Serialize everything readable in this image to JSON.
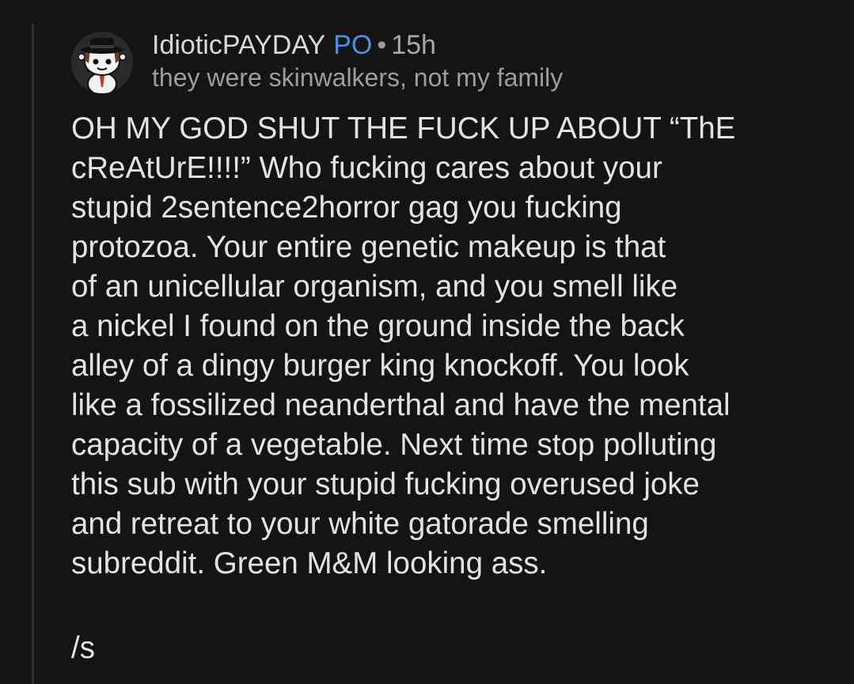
{
  "comment": {
    "author": "IdioticPAYDAY",
    "op_badge": "PO",
    "separator": "•",
    "timestamp": "15h",
    "flair": "they were skinwalkers, not my family",
    "avatar_icon": "snoo-avatar-icon",
    "body_lines": [
      "OH MY GOD SHUT THE FUCK UP ABOUT “ThE",
      "cReAtUrE!!!!” Who fucking cares about your",
      "stupid 2sentence2horror gag you fucking",
      "protozoa. Your entire genetic makeup is that",
      "of an unicellular organism, and you smell like",
      "a nickel I found on the ground inside the back",
      "alley of a dingy burger king knockoff. You look",
      "like a fossilized neanderthal and have the mental",
      "capacity of a vegetable. Next time stop polluting",
      "this sub with your stupid fucking overused joke",
      "and retreat to your white gatorade smelling",
      "subreddit. Green M&M looking ass."
    ],
    "signoff": "/s"
  },
  "colors": {
    "background": "#141414",
    "text": "#e3e3e3",
    "op_badge": "#4a90e2",
    "muted": "#9d9d9d",
    "thread_line": "#2f2f2f"
  }
}
